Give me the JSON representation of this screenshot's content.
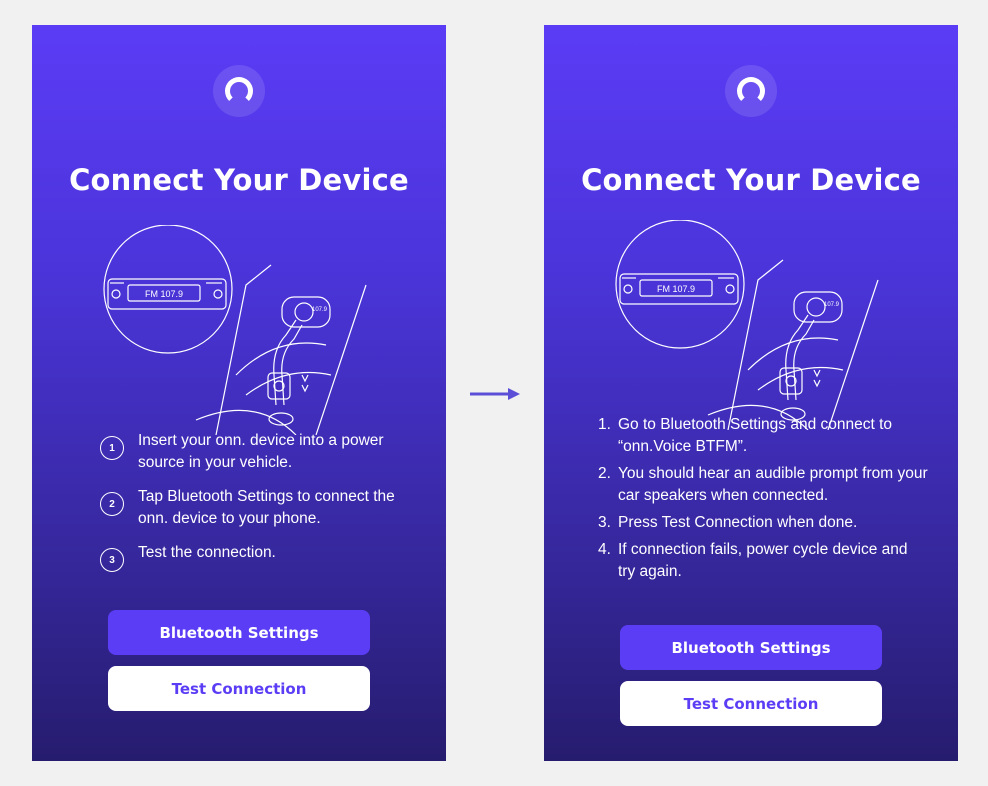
{
  "colors": {
    "page_bg": "#f1f1f1",
    "gradient_top": "#5b3cf6",
    "gradient_bottom": "#261c6e",
    "button_primary": "#5b3df5",
    "button_secondary": "#ffffff",
    "arrow": "#5b4fd8"
  },
  "left_screen": {
    "logo_icon": "onn-logo-icon",
    "title": "Connect Your Device",
    "illustration": {
      "radio_label": "FM 107.9",
      "device_display": "107.9"
    },
    "steps": [
      {
        "number": "1",
        "text": "Insert your onn. device into a power source in your vehicle."
      },
      {
        "number": "2",
        "text": "Tap Bluetooth Settings to connect the onn. device to your phone."
      },
      {
        "number": "3",
        "text": "Test the connection."
      }
    ],
    "primary_button": "Bluetooth Settings",
    "secondary_button": "Test Connection"
  },
  "arrow_icon": "arrow-right-icon",
  "right_screen": {
    "logo_icon": "onn-logo-icon",
    "title": "Connect Your Device",
    "illustration": {
      "radio_label": "FM 107.9",
      "device_display": "107.9"
    },
    "steps": [
      {
        "number": "1.",
        "text": "Go to Bluetooth Settings and connect to “onn.Voice BTFM”."
      },
      {
        "number": "2.",
        "text": "You should hear an audible prompt from your car speakers when connected."
      },
      {
        "number": "3.",
        "text": "Press Test Connection when done."
      },
      {
        "number": "4.",
        "text": "If connection fails, power cycle device and try again."
      }
    ],
    "primary_button": "Bluetooth Settings",
    "secondary_button": "Test Connection"
  }
}
